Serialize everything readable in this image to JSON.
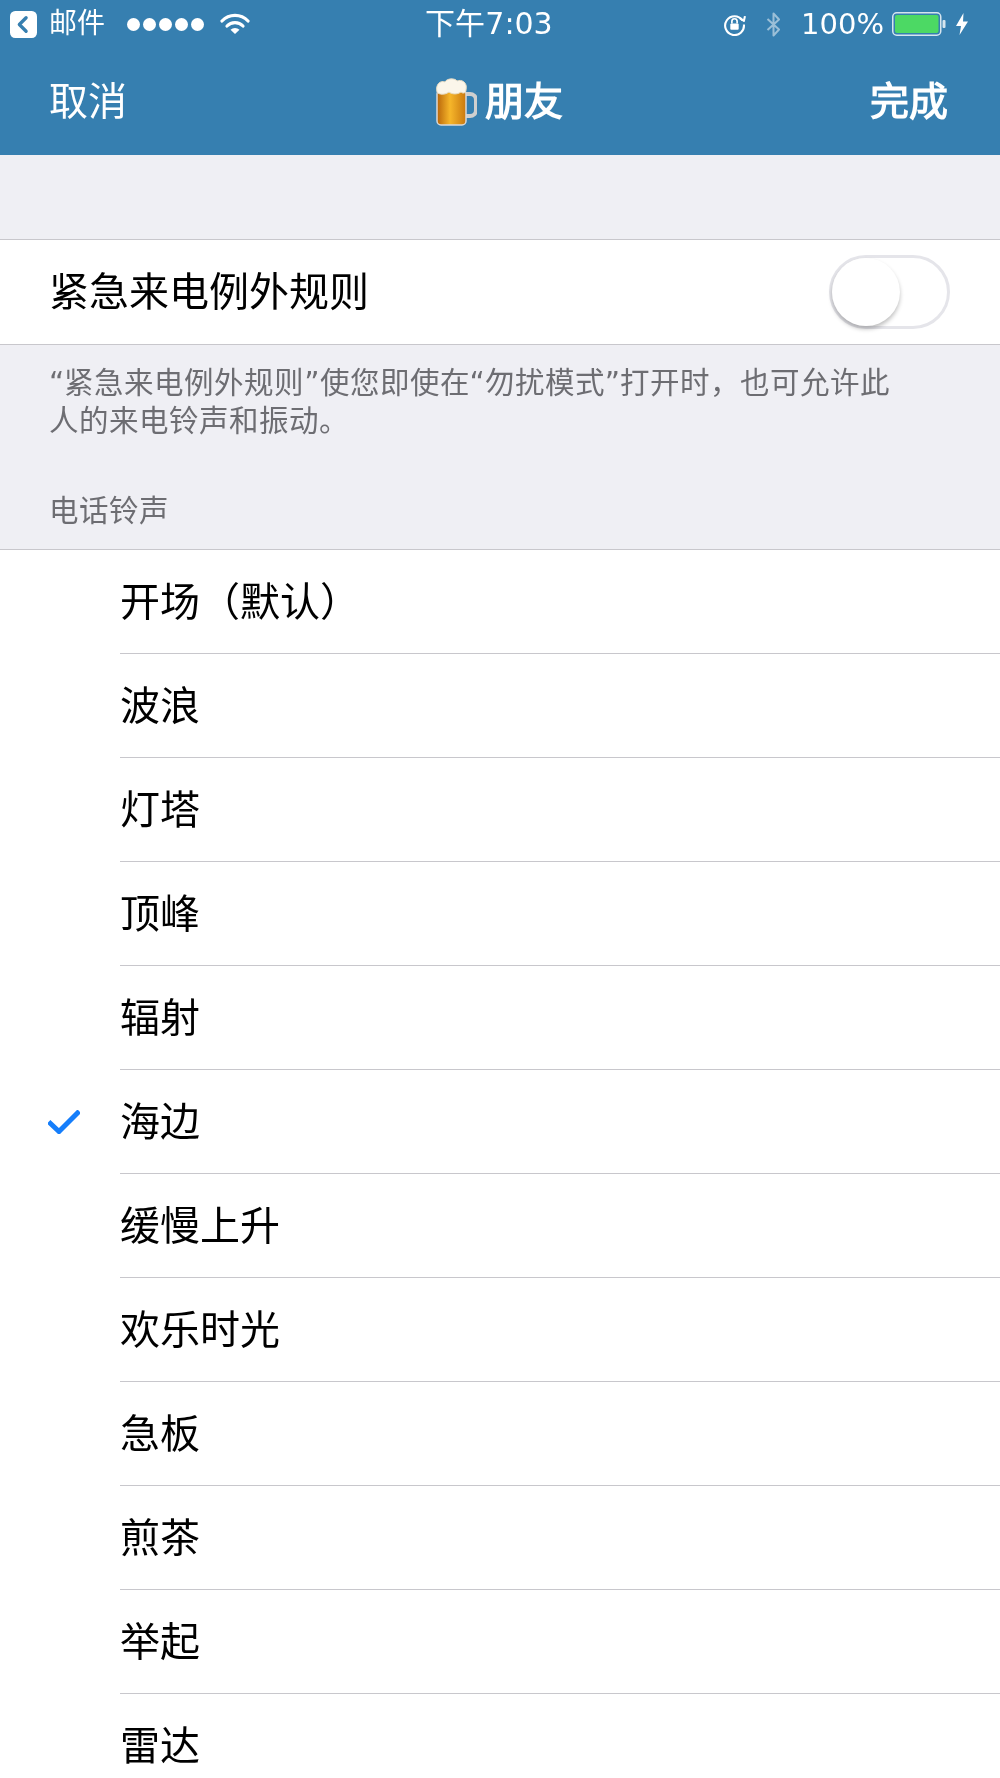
{
  "status_bar": {
    "back_app": "邮件",
    "time": "下午7:03",
    "battery": "100%"
  },
  "nav_bar": {
    "cancel": "取消",
    "title": "朋友",
    "done": "完成"
  },
  "emergency_bypass": {
    "label": "紧急来电例外规则",
    "on": false,
    "footer": "“紧急来电例外规则”使您即使在“勿扰模式”打开时，也可允许此人的来电铃声和振动。"
  },
  "ringtones": {
    "header": "电话铃声",
    "items": [
      {
        "name": "开场（默认）",
        "selected": false
      },
      {
        "name": "波浪",
        "selected": false
      },
      {
        "name": "灯塔",
        "selected": false
      },
      {
        "name": "顶峰",
        "selected": false
      },
      {
        "name": "辐射",
        "selected": false
      },
      {
        "name": "海边",
        "selected": true
      },
      {
        "name": "缓慢上升",
        "selected": false
      },
      {
        "name": "欢乐时光",
        "selected": false
      },
      {
        "name": "急板",
        "selected": false
      },
      {
        "name": "煎茶",
        "selected": false
      },
      {
        "name": "举起",
        "selected": false
      },
      {
        "name": "雷达",
        "selected": false
      }
    ]
  }
}
